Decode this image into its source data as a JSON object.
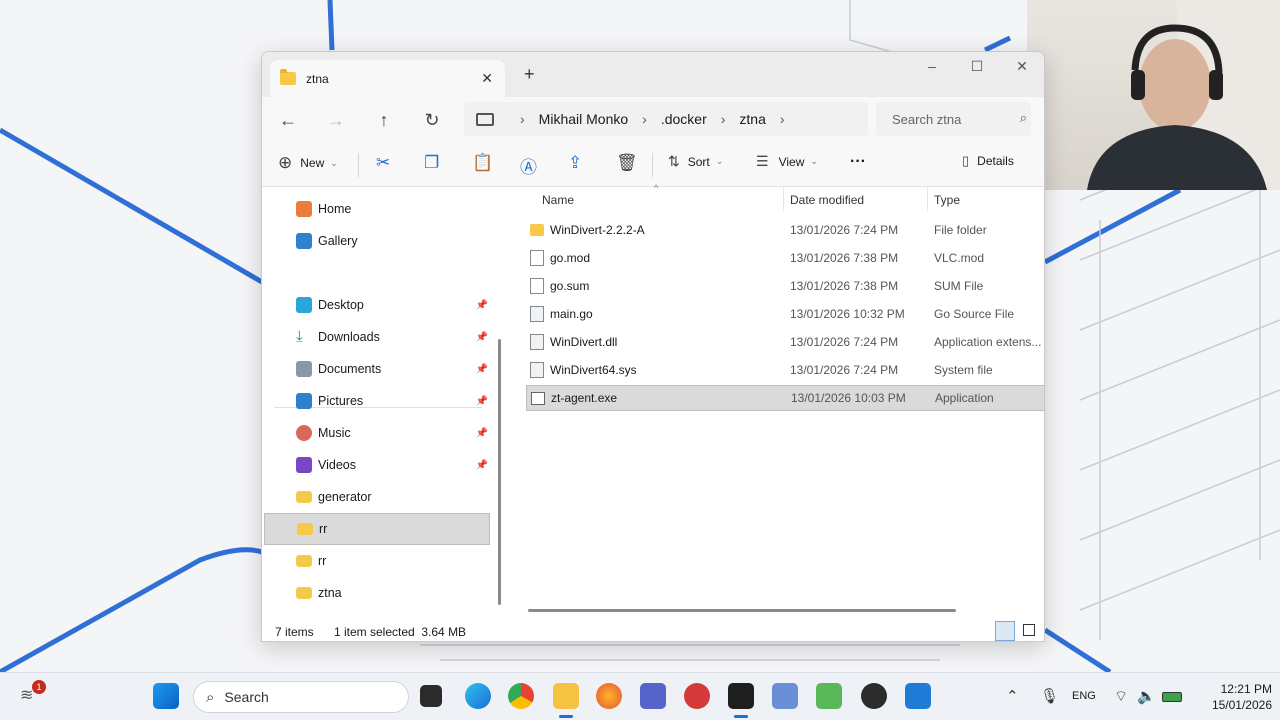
{
  "window": {
    "tab_title": "ztna",
    "new_tab_symbol": "+",
    "close_symbol": "✕"
  },
  "nav": {
    "back": "←",
    "forward": "→",
    "up": "↑",
    "refresh": "↻",
    "breadcrumb": [
      "Mikhail Monko",
      ".docker",
      "ztna"
    ],
    "separator": "›",
    "search_placeholder": "Search ztna"
  },
  "toolbar": {
    "new_label": "New",
    "sort_label": "Sort",
    "view_label": "View",
    "more_label": "···",
    "details_label": "Details"
  },
  "sidebar": {
    "items": [
      {
        "label": "Home",
        "icon": "home-icon",
        "pinned": false
      },
      {
        "label": "Gallery",
        "icon": "gallery-icon",
        "pinned": false
      },
      {
        "label": "Desktop",
        "icon": "desktop-icon",
        "pinned": true
      },
      {
        "label": "Downloads",
        "icon": "download-icon",
        "pinned": true
      },
      {
        "label": "Documents",
        "icon": "documents-icon",
        "pinned": true
      },
      {
        "label": "Pictures",
        "icon": "pictures-icon",
        "pinned": true
      },
      {
        "label": "Music",
        "icon": "music-icon",
        "pinned": true
      },
      {
        "label": "Videos",
        "icon": "videos-icon",
        "pinned": true
      },
      {
        "label": "generator",
        "icon": "folder-icon",
        "pinned": false
      },
      {
        "label": "rr",
        "icon": "folder-icon",
        "pinned": false,
        "selected": true
      },
      {
        "label": "rr",
        "icon": "folder-icon",
        "pinned": false
      },
      {
        "label": "ztna",
        "icon": "folder-icon",
        "pinned": false
      }
    ]
  },
  "columns": {
    "name": "Name",
    "date": "Date modified",
    "type": "Type"
  },
  "files": [
    {
      "name": "WinDivert-2.2.2-A",
      "date": "13/01/2026 7:24 PM",
      "type": "File folder",
      "icon": "folder-icon"
    },
    {
      "name": "go.mod",
      "date": "13/01/2026 7:38 PM",
      "type": "VLC.mod",
      "icon": "file-icon"
    },
    {
      "name": "go.sum",
      "date": "13/01/2026 7:38 PM",
      "type": "SUM File",
      "icon": "file-icon"
    },
    {
      "name": "main.go",
      "date": "13/01/2026 10:32 PM",
      "type": "Go Source File",
      "icon": "go-file-icon"
    },
    {
      "name": "WinDivert.dll",
      "date": "13/01/2026 7:24 PM",
      "type": "Application extens...",
      "icon": "dll-icon"
    },
    {
      "name": "WinDivert64.sys",
      "date": "13/01/2026 7:24 PM",
      "type": "System file",
      "icon": "sys-file-icon"
    },
    {
      "name": "zt-agent.exe",
      "date": "13/01/2026 10:03 PM",
      "type": "Application",
      "icon": "exe-icon",
      "selected": true
    }
  ],
  "status": {
    "item_count": "7 items",
    "selection": "1 item selected  3.64 MB"
  },
  "taskbar": {
    "search_label": "Search",
    "notification_count": "1",
    "language": "ENG",
    "time": "12:21 PM",
    "date": "15/01/2026"
  },
  "colors": {
    "accent": "#1f6fd1",
    "folder": "#f7c948",
    "selection_bg": "#dadada"
  }
}
